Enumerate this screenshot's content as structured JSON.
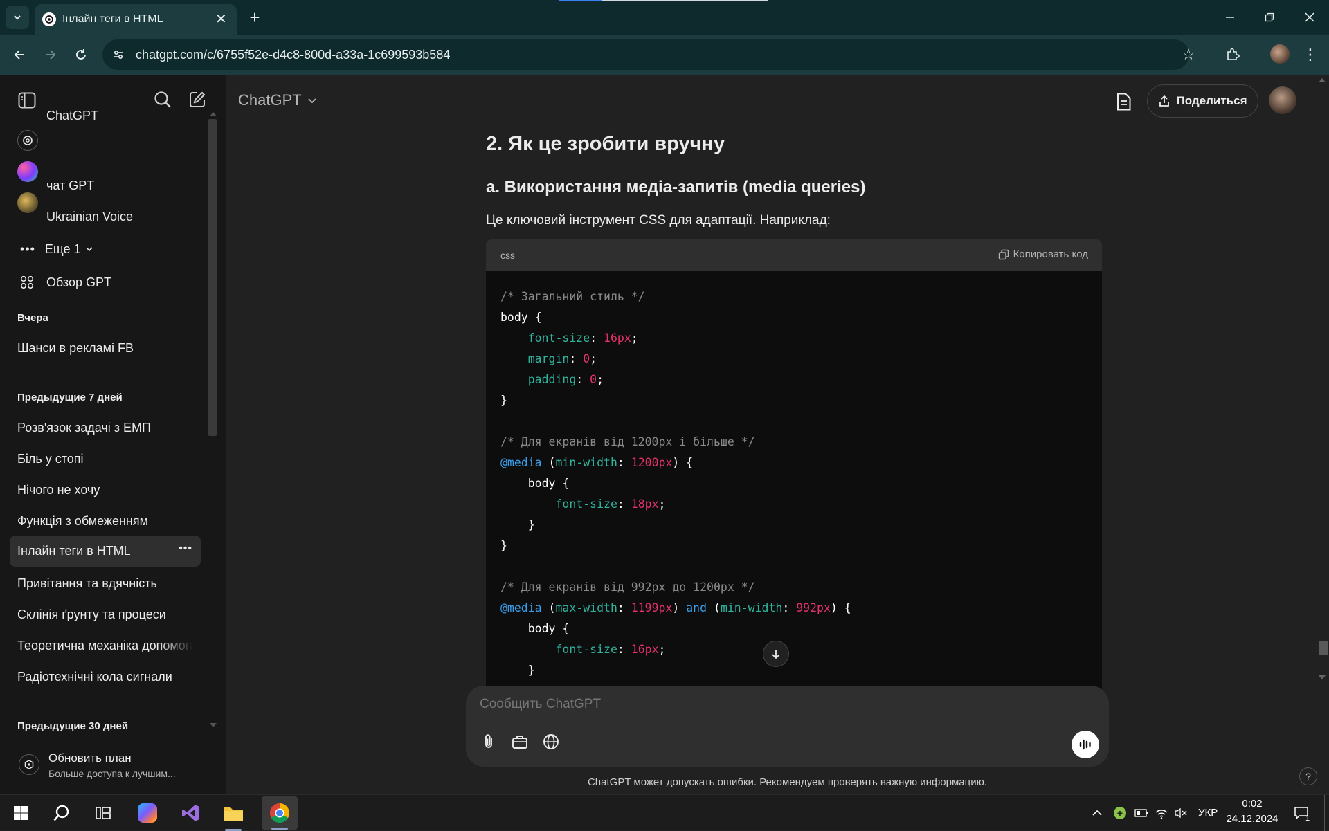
{
  "browser": {
    "tab_title": "Інлайн теги в HTML",
    "url": "chatgpt.com/c/6755f52e-d4c8-800d-a33a-1c699593b584"
  },
  "sidebar": {
    "gpts": [
      {
        "label": "ChatGPT"
      },
      {
        "label": "чат GPT"
      },
      {
        "label": "Ukrainian Voice"
      }
    ],
    "more_label": "Еще 1",
    "explore_label": "Обзор GPT",
    "sections": [
      {
        "title": "Вчера",
        "items": [
          "Шанси в рекламі FB"
        ]
      },
      {
        "title": "Предыдущие 7 дней",
        "items": [
          "Розв'язок задачі з ЕМП",
          "Біль у стопі",
          "Нічого не хочу",
          "Функція з обмеженням",
          "Інлайн теги в HTML",
          "Привітання та вдячність",
          "Склінія ґрунту та процеси",
          "Теоретична механіка допомога",
          "Радіотехнічні кола сигнали"
        ]
      },
      {
        "title": "Предыдущие 30 дней",
        "items": []
      }
    ],
    "upgrade_title": "Обновить план",
    "upgrade_subtitle": "Больше доступа к лучшим..."
  },
  "header": {
    "model_label": "ChatGPT",
    "share_label": "Поделиться"
  },
  "content": {
    "h2": "2. Як це зробити вручну",
    "h3": "a. Використання медіа-запитів (media queries)",
    "para": "Це ключовий інструмент CSS для адаптації. Наприклад:",
    "code_lang": "css",
    "copy_label": "Копировать код"
  },
  "composer": {
    "placeholder": "Сообщить ChatGPT",
    "disclaimer": "ChatGPT может допускать ошибки. Рекомендуем проверять важную информацию.",
    "help": "?"
  },
  "taskbar": {
    "lang": "УКР",
    "time": "0:02",
    "date": "24.12.2024",
    "notif_count": "1"
  },
  "colors": {
    "sidebar_bg": "#171717",
    "main_bg": "#212121",
    "code_bg": "#0d0d0d",
    "code_header_bg": "#2f2f2f",
    "tabbar_bg": "#0f2a2c",
    "comment": "#8a8a8a",
    "property": "#2fb39e",
    "number": "#e6316a",
    "keyword": "#3b9ee8"
  }
}
